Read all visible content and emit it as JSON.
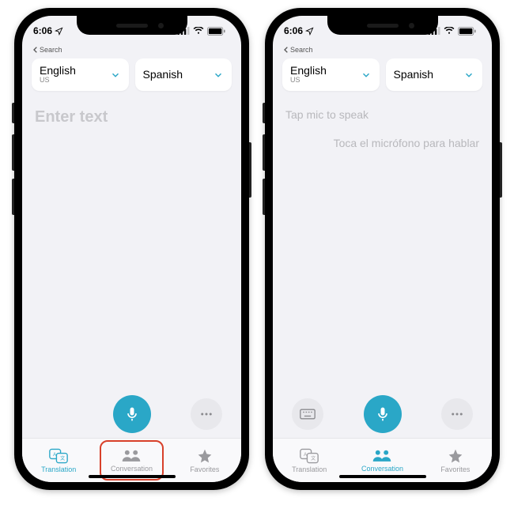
{
  "status": {
    "time": "6:06",
    "back_label": "Search"
  },
  "languages": {
    "source": {
      "name": "English",
      "region": "US"
    },
    "target": {
      "name": "Spanish",
      "region": ""
    }
  },
  "left": {
    "placeholder": "Enter text",
    "tabs": {
      "translation": "Translation",
      "conversation": "Conversation",
      "favorites": "Favorites"
    },
    "active_tab": "translation",
    "highlighted_tab": "conversation"
  },
  "right": {
    "hint_primary": "Tap mic to speak",
    "hint_secondary": "Toca el micrófono para hablar",
    "tabs": {
      "translation": "Translation",
      "conversation": "Conversation",
      "favorites": "Favorites"
    },
    "active_tab": "conversation"
  },
  "colors": {
    "accent": "#2aa7c7",
    "highlight": "#d8402a"
  }
}
